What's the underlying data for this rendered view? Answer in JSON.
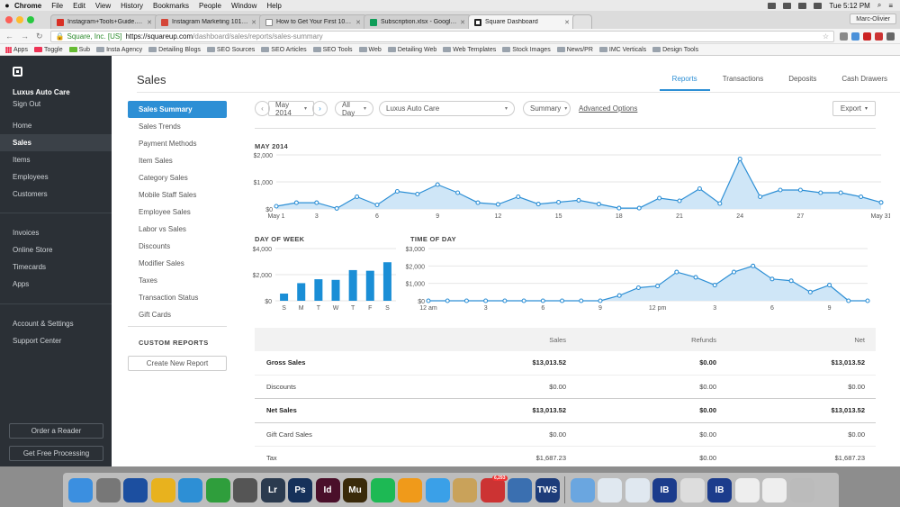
{
  "menubar": {
    "app": "Chrome",
    "items": [
      "File",
      "Edit",
      "View",
      "History",
      "Bookmarks",
      "People",
      "Window",
      "Help"
    ],
    "clock": "Tue 5:12 PM"
  },
  "tabs": [
    {
      "title": "Instagram+Tools+Guide.pdf",
      "color": "#d93025"
    },
    {
      "title": "Instagram Marketing 101 eBo",
      "color": "#d44638"
    },
    {
      "title": "How to Get Your First 10,000",
      "color": "#888888"
    },
    {
      "title": "Subscription.xlsx - Google Sh",
      "color": "#0f9d58"
    },
    {
      "title": "Square Dashboard",
      "color": "#222222"
    }
  ],
  "profile": "Marc-Olivier",
  "address": {
    "org": "Square, Inc. [US]",
    "host": "https://squareup.com",
    "path": "/dashboard/sales/reports/sales-summary"
  },
  "bookmarks": [
    "Apps",
    "Toggle",
    "Sub",
    "Insta Agency",
    "Detailing Blogs",
    "SEO Sources",
    "SEO Articles",
    "SEO Tools",
    "Web",
    "Detailing Web",
    "Web Templates",
    "Stock Images",
    "News/PR",
    "IMC Verticals",
    "Design Tools"
  ],
  "sidebar": {
    "business": "Luxus Auto Care",
    "signout": "Sign Out",
    "nav1": [
      "Home",
      "Sales",
      "Items",
      "Employees",
      "Customers"
    ],
    "nav2": [
      "Invoices",
      "Online Store",
      "Timecards",
      "Apps"
    ],
    "nav3": [
      "Account & Settings",
      "Support Center"
    ],
    "order_reader": "Order a Reader",
    "free_processing": "Get Free Processing"
  },
  "page": {
    "title": "Sales",
    "tabs": [
      "Reports",
      "Transactions",
      "Deposits",
      "Cash Drawers"
    ]
  },
  "reports_nav": [
    "Sales Summary",
    "Sales Trends",
    "Payment Methods",
    "Item Sales",
    "Category Sales",
    "Mobile Staff Sales",
    "Employee Sales",
    "Labor vs Sales",
    "Discounts",
    "Modifier Sales",
    "Taxes",
    "Transaction Status",
    "Gift Cards"
  ],
  "custom_reports": {
    "heading": "CUSTOM REPORTS",
    "create": "Create New Report"
  },
  "filters": {
    "prev": "‹",
    "date": "May 2014",
    "next": "›",
    "time": "All Day",
    "location": "Luxus Auto Care",
    "summary": "Summary",
    "advanced": "Advanced Options",
    "export": "Export"
  },
  "chart_data": [
    {
      "type": "area",
      "title": "MAY 2014",
      "y_ticks": [
        "$2,000",
        "$1,000",
        "$0"
      ],
      "ylim": [
        0,
        2000
      ],
      "x_tick_labels": [
        "May 1",
        "3",
        "6",
        "9",
        "12",
        "15",
        "18",
        "21",
        "24",
        "27",
        "May 31"
      ],
      "x": [
        1,
        2,
        3,
        4,
        5,
        6,
        7,
        8,
        9,
        10,
        11,
        12,
        13,
        14,
        15,
        16,
        17,
        18,
        19,
        20,
        21,
        22,
        23,
        24,
        25,
        26,
        27,
        28,
        29,
        30,
        31
      ],
      "values": [
        100,
        230,
        230,
        20,
        450,
        150,
        650,
        550,
        900,
        600,
        230,
        170,
        450,
        180,
        250,
        320,
        180,
        30,
        30,
        400,
        300,
        750,
        200,
        1850,
        450,
        700,
        700,
        600,
        600,
        450,
        240
      ],
      "color": "#2d8fd5"
    },
    {
      "type": "bar",
      "title": "DAY OF WEEK",
      "y_ticks": [
        "$4,000",
        "$2,000",
        "$0"
      ],
      "ylim": [
        0,
        4000
      ],
      "categories": [
        "S",
        "M",
        "T",
        "W",
        "T",
        "F",
        "S"
      ],
      "values": [
        550,
        1350,
        1650,
        1600,
        2350,
        2300,
        2950
      ],
      "color": "#1a8ed6"
    },
    {
      "type": "area",
      "title": "TIME OF DAY",
      "y_ticks": [
        "$3,000",
        "$2,000",
        "$1,000",
        "$0"
      ],
      "ylim": [
        0,
        3000
      ],
      "x_tick_labels": [
        "12 am",
        "3",
        "6",
        "9",
        "12 pm",
        "3",
        "6",
        "9"
      ],
      "values": [
        0,
        0,
        0,
        0,
        0,
        0,
        0,
        0,
        0,
        0,
        300,
        750,
        850,
        1650,
        1350,
        900,
        1650,
        2000,
        1250,
        1150,
        500,
        900,
        0,
        0
      ],
      "color": "#2d8fd5"
    }
  ],
  "table": {
    "columns": [
      "",
      "Sales",
      "Refunds",
      "Net"
    ],
    "rows": [
      {
        "label": "Gross Sales",
        "sales": "$13,013.52",
        "refunds": "$0.00",
        "net": "$13,013.52"
      },
      {
        "label": "Discounts",
        "sales": "$0.00",
        "refunds": "$0.00",
        "net": "$0.00"
      },
      {
        "label": "Net Sales",
        "sales": "$13,013.52",
        "refunds": "$0.00",
        "net": "$13,013.52"
      },
      {
        "label": "Gift Card Sales",
        "sales": "$0.00",
        "refunds": "$0.00",
        "net": "$0.00"
      },
      {
        "label": "Tax",
        "sales": "$1,687.23",
        "refunds": "$0.00",
        "net": "$1,687.23"
      }
    ]
  },
  "dock": [
    {
      "name": "finder-icon",
      "color": "#3b8fe0",
      "label": ""
    },
    {
      "name": "system-preferences-icon",
      "color": "#777",
      "label": ""
    },
    {
      "name": "mail-bird-icon",
      "color": "#1c4fa0",
      "label": ""
    },
    {
      "name": "chrome-icon",
      "color": "#e8b21e",
      "label": ""
    },
    {
      "name": "safari-icon",
      "color": "#2d8fd5",
      "label": ""
    },
    {
      "name": "evernote-icon",
      "color": "#2f9e3c",
      "label": ""
    },
    {
      "name": "photo-icon",
      "color": "#555",
      "label": ""
    },
    {
      "name": "lightroom-icon",
      "color": "#2b3b4f",
      "label": "Lr"
    },
    {
      "name": "photoshop-icon",
      "color": "#16315a",
      "label": "Ps"
    },
    {
      "name": "indesign-icon",
      "color": "#4a0f2a",
      "label": "Id"
    },
    {
      "name": "muse-icon",
      "color": "#3a2a0a",
      "label": "Mu"
    },
    {
      "name": "spotify-icon",
      "color": "#1db954",
      "label": ""
    },
    {
      "name": "messages-icon",
      "color": "#f09a1a",
      "label": ""
    },
    {
      "name": "chat-icon",
      "color": "#3aa0e8",
      "label": ""
    },
    {
      "name": "notes-icon",
      "color": "#c9a25a",
      "label": ""
    },
    {
      "name": "airmail-icon",
      "color": "#c33",
      "label": "",
      "badge": "6,293"
    },
    {
      "name": "stocks-icon",
      "color": "#3a6fb0",
      "label": ""
    },
    {
      "name": "tws-icon",
      "color": "#1d3c7a",
      "label": "TWS"
    },
    {
      "name": "downloads-folder-icon",
      "color": "#6aa6e0",
      "label": ""
    },
    {
      "name": "chart-window-icon",
      "color": "#e0e8f0",
      "label": ""
    },
    {
      "name": "chart-window-icon-2",
      "color": "#e0e8f0",
      "label": ""
    },
    {
      "name": "ib-icon",
      "color": "#1c3c8c",
      "label": "IB"
    },
    {
      "name": "document-icon",
      "color": "#ddd",
      "label": ""
    },
    {
      "name": "ib-icon-2",
      "color": "#1c3c8c",
      "label": "IB"
    },
    {
      "name": "preview-icon",
      "color": "#eee",
      "label": ""
    },
    {
      "name": "spreadsheet-icon",
      "color": "#eee",
      "label": ""
    },
    {
      "name": "trash-icon",
      "color": "#bbb",
      "label": ""
    }
  ]
}
